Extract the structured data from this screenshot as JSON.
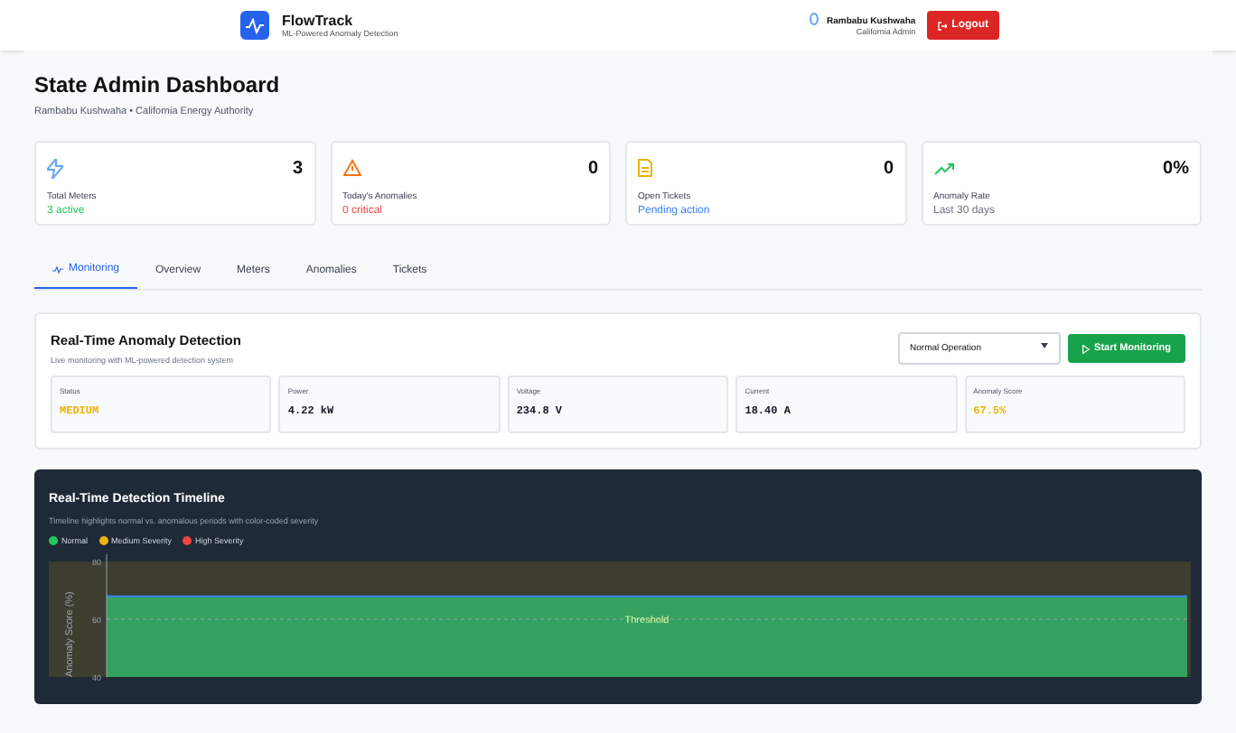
{
  "header": {
    "app_name": "FlowTrack",
    "tagline": "ML-Powered Anomaly Detection",
    "user_name": "Rambabu Kushwaha",
    "user_role": "California Admin",
    "logout": "Logout"
  },
  "page": {
    "title": "State Admin Dashboard",
    "subtitle": "Rambabu Kushwaha • California Energy Authority"
  },
  "stats": [
    {
      "kind": "meters",
      "value": "3",
      "label": "Total Meters",
      "note": "3 active",
      "color": "#22c55e"
    },
    {
      "kind": "anomalies",
      "value": "0",
      "label": "Today's Anomalies",
      "note": "0 critical",
      "color": "#ef4444"
    },
    {
      "kind": "tickets",
      "value": "0",
      "label": "Open Tickets",
      "note": "Pending action",
      "color": "#3b82f6"
    },
    {
      "kind": "rate",
      "value": "0%",
      "label": "Anomaly Rate",
      "note": "Last 30 days",
      "color": "#6b7280"
    }
  ],
  "tabs": [
    {
      "label": "Monitoring",
      "selected": true
    },
    {
      "label": "Overview",
      "selected": false
    },
    {
      "label": "Meters",
      "selected": false
    },
    {
      "label": "Anomalies",
      "selected": false
    },
    {
      "label": "Tickets",
      "selected": false
    }
  ],
  "detection": {
    "title": "Real-Time Anomaly Detection",
    "subtitle": "Live monitoring with ML-powered detection system",
    "mode": "Normal Operation",
    "start": "Start Monitoring",
    "readings": [
      {
        "label": "Status",
        "value": "MEDIUM",
        "color": "#eab308"
      },
      {
        "label": "Power",
        "value": "4.22 kW",
        "color": "#111827"
      },
      {
        "label": "Voltage",
        "value": "234.8 V",
        "color": "#111827"
      },
      {
        "label": "Current",
        "value": "18.40 A",
        "color": "#111827"
      },
      {
        "label": "Anomaly Score",
        "value": "67.5%",
        "color": "#eab308"
      }
    ]
  },
  "timeline": {
    "title": "Real-Time Detection Timeline",
    "subtitle": "Timeline highlights normal vs. anomalous periods with color-coded severity",
    "legend": [
      {
        "label": "Normal",
        "color": "#22c55e"
      },
      {
        "label": "Medium Severity",
        "color": "#eab308"
      },
      {
        "label": "High Severity",
        "color": "#ef4444"
      }
    ],
    "chart": {
      "y_axis_title": "Anomaly Score (%)",
      "y_tick_labels": [
        "80",
        "60",
        "40"
      ],
      "threshold_label": "Threshold"
    }
  }
}
